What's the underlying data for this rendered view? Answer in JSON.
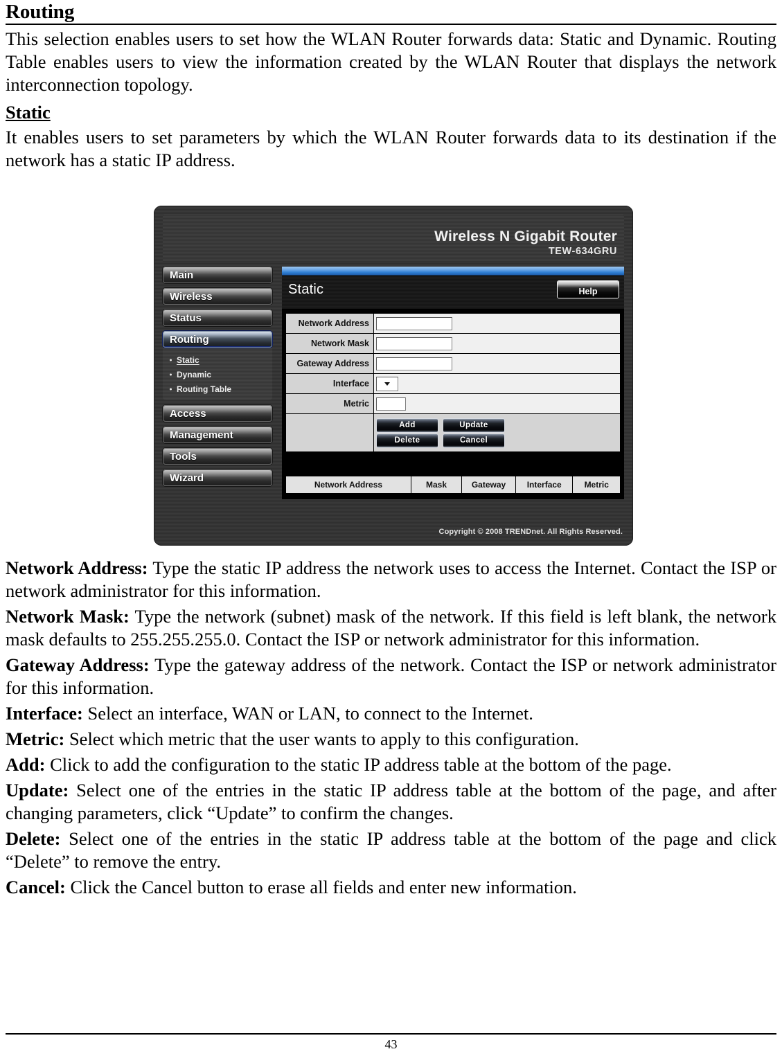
{
  "document": {
    "heading": "Routing",
    "intro": "This selection enables users to set how the WLAN Router forwards data: Static and Dynamic. Routing Table enables users to view the information created by the WLAN Router that displays the network interconnection topology.",
    "sub_heading": "Static",
    "sub_intro": "It enables users to set parameters by which the WLAN Router forwards data to its destination if the network has a static IP address.",
    "definitions": [
      {
        "term": "Network Address:",
        "text": " Type the static IP address the network uses to access the Internet. Contact the ISP or network administrator for this information."
      },
      {
        "term": "Network Mask:",
        "text": " Type the network (subnet) mask of the network. If this field is left blank, the network mask defaults to 255.255.255.0.  Contact the ISP or network administrator for this information."
      },
      {
        "term": "Gateway Address:",
        "text": " Type the gateway address of the network. Contact the ISP or network administrator for this information."
      },
      {
        "term": "Interface:",
        "text": " Select an interface, WAN or LAN, to connect to the Internet."
      },
      {
        "term": "Metric:",
        "text": " Select which metric that the user wants to apply to this configuration."
      },
      {
        "term": "Add:",
        "text": " Click to add the configuration to the static IP address table at the bottom of the page."
      },
      {
        "term": "Update:",
        "text": " Select one of the entries in the static IP address table at the bottom of the page, and after changing parameters, click “Update” to confirm the changes."
      },
      {
        "term": "Delete:",
        "text": " Select one of the entries in the static IP address table at the bottom of the page and click “Delete” to remove the entry."
      },
      {
        "term": "Cancel:",
        "text": " Click the Cancel button to erase all fields and enter new information."
      }
    ],
    "page_number": "43"
  },
  "router_ui": {
    "brand": {
      "product_name": "Wireless N Gigabit Router",
      "model": "TEW-634GRU"
    },
    "sidebar": {
      "items": [
        {
          "label": "Main",
          "active": false
        },
        {
          "label": "Wireless",
          "active": false
        },
        {
          "label": "Status",
          "active": false
        },
        {
          "label": "Routing",
          "active": true
        },
        {
          "label": "Access",
          "active": false
        },
        {
          "label": "Management",
          "active": false
        },
        {
          "label": "Tools",
          "active": false
        },
        {
          "label": "Wizard",
          "active": false
        }
      ],
      "sub_items": [
        {
          "label": "Static",
          "selected": true
        },
        {
          "label": "Dynamic",
          "selected": false
        },
        {
          "label": "Routing Table",
          "selected": false
        }
      ]
    },
    "panel": {
      "title": "Static",
      "help_label": "Help",
      "fields": [
        {
          "label": "Network Address",
          "value": "",
          "type": "text"
        },
        {
          "label": "Network Mask",
          "value": "",
          "type": "text"
        },
        {
          "label": "Gateway Address",
          "value": "",
          "type": "text"
        },
        {
          "label": "Interface",
          "value": "",
          "type": "select"
        },
        {
          "label": "Metric",
          "value": "",
          "type": "text-small"
        }
      ],
      "buttons": [
        {
          "label": "Add"
        },
        {
          "label": "Update"
        },
        {
          "label": "Delete"
        },
        {
          "label": "Cancel"
        }
      ],
      "results_table": {
        "columns": [
          "Network Address",
          "Mask",
          "Gateway",
          "Interface",
          "Metric"
        ],
        "rows": []
      }
    },
    "copyright": "Copyright © 2008 TRENDnet. All Rights Reserved.",
    "colors": {
      "accent_blue": "#2f7fd4",
      "panel_black": "#000000",
      "chrome_gray": "#3a3a3a"
    }
  }
}
